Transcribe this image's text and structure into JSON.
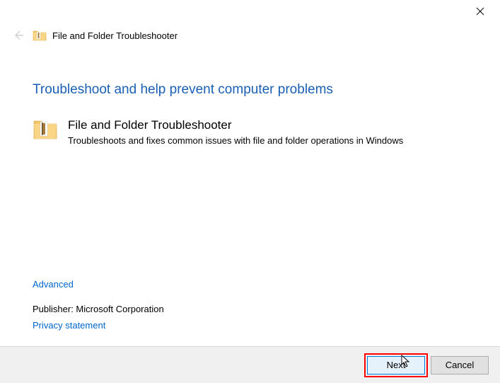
{
  "titlebar": {
    "close_label": "Close"
  },
  "header": {
    "window_title": "File and Folder Troubleshooter"
  },
  "content": {
    "heading": "Troubleshoot and help prevent computer problems",
    "troubleshooter": {
      "title": "File and Folder Troubleshooter",
      "description": "Troubleshoots and fixes common issues with file and folder operations in Windows"
    }
  },
  "links": {
    "advanced": "Advanced",
    "publisher_label": "Publisher:  ",
    "publisher_name": "Microsoft Corporation",
    "privacy": "Privacy statement"
  },
  "buttons": {
    "next": "Next",
    "cancel": "Cancel"
  }
}
